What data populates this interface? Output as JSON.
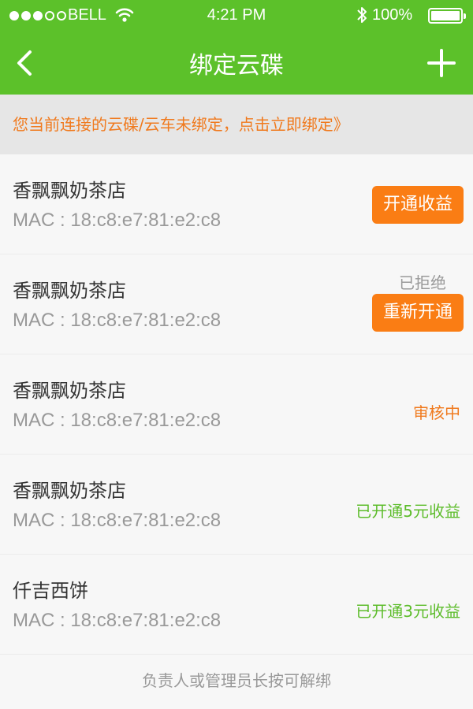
{
  "status_bar": {
    "carrier": "BELL",
    "time": "4:21 PM",
    "battery_percent": "100%",
    "signal_bars_filled": 3,
    "signal_bars_total": 5
  },
  "nav": {
    "title": "绑定云碟",
    "back_icon": "chevron-left-icon",
    "add_icon": "plus-icon"
  },
  "notice": {
    "text": "您当前连接的云碟/云车未绑定，点击立即绑定》"
  },
  "devices": [
    {
      "name": "香飘飘奶茶店",
      "mac": "MAC : 18:c8:e7:81:e2:c8",
      "status": "",
      "action": "开通收益"
    },
    {
      "name": "香飘飘奶茶店",
      "mac": "MAC : 18:c8:e7:81:e2:c8",
      "status": "已拒绝",
      "action": "重新开通"
    },
    {
      "name": "香飘飘奶茶店",
      "mac": "MAC : 18:c8:e7:81:e2:c8",
      "status": "审核中",
      "action": ""
    },
    {
      "name": "香飘飘奶茶店",
      "mac": "MAC : 18:c8:e7:81:e2:c8",
      "status": "已开通5元收益",
      "action": ""
    },
    {
      "name": "仟吉西饼",
      "mac": "MAC : 18:c8:e7:81:e2:c8",
      "status": "已开通3元收益",
      "action": ""
    }
  ],
  "footer": {
    "hint": "负责人或管理员长按可解绑"
  },
  "colors": {
    "brand_green": "#5cc12a",
    "accent_orange": "#fa7d14",
    "status_green": "#5cbc2a",
    "muted_gray": "#999999"
  }
}
